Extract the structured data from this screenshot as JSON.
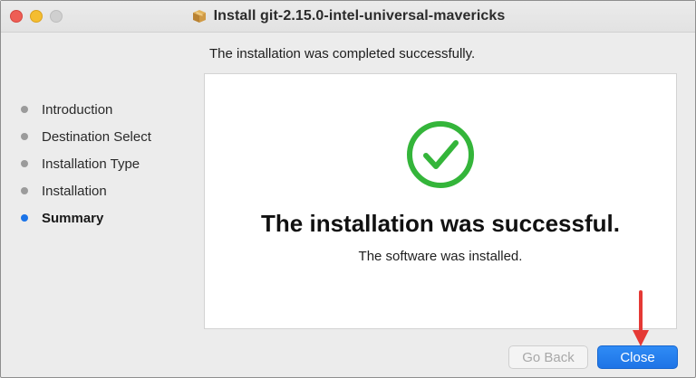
{
  "window": {
    "title": "Install git-2.15.0-intel-universal-mavericks",
    "title_icon": "package-icon"
  },
  "header": {
    "message": "The installation was completed successfully."
  },
  "sidebar": {
    "steps": [
      {
        "label": "Introduction",
        "active": false
      },
      {
        "label": "Destination Select",
        "active": false
      },
      {
        "label": "Installation Type",
        "active": false
      },
      {
        "label": "Installation",
        "active": false
      },
      {
        "label": "Summary",
        "active": true
      }
    ]
  },
  "content": {
    "status_icon": "checkmark-circle-icon",
    "heading": "The installation was successful.",
    "subtext": "The software was installed."
  },
  "buttons": {
    "back_label": "Go Back",
    "close_label": "Close"
  },
  "colors": {
    "success_green": "#34b53a",
    "accent_blue": "#1e74e6",
    "annotation_red": "#e53935",
    "active_step_dot": "#1a73e8"
  }
}
